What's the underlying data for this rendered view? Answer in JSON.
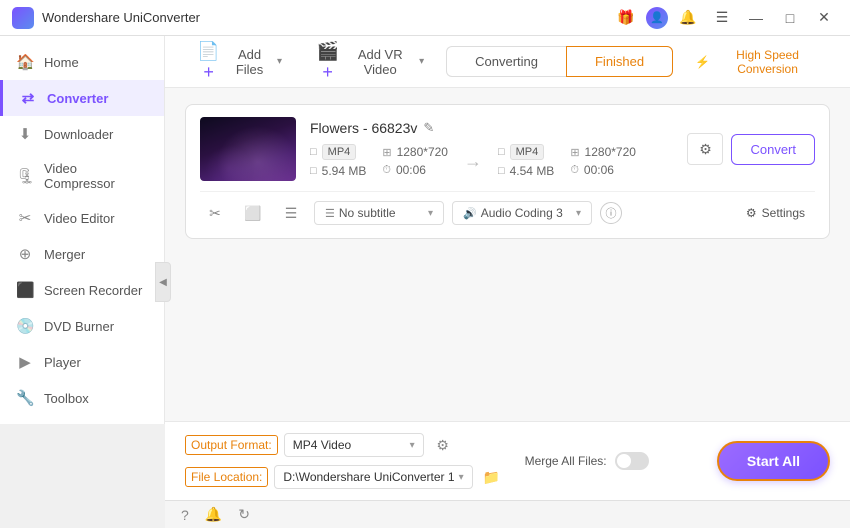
{
  "titlebar": {
    "app_name": "Wondershare UniConverter",
    "controls": {
      "gift_icon": "🎁",
      "user_icon": "👤",
      "bell_icon": "🔔",
      "menu_icon": "☰",
      "minimize_icon": "—",
      "maximize_icon": "□",
      "close_icon": "✕"
    }
  },
  "sidebar": {
    "items": [
      {
        "id": "home",
        "label": "Home",
        "icon": "🏠"
      },
      {
        "id": "converter",
        "label": "Converter",
        "icon": "⇄",
        "active": true
      },
      {
        "id": "downloader",
        "label": "Downloader",
        "icon": "⬇"
      },
      {
        "id": "video-compressor",
        "label": "Video Compressor",
        "icon": "🗜"
      },
      {
        "id": "video-editor",
        "label": "Video Editor",
        "icon": "✂"
      },
      {
        "id": "merger",
        "label": "Merger",
        "icon": "⊕"
      },
      {
        "id": "screen-recorder",
        "label": "Screen Recorder",
        "icon": "⬛"
      },
      {
        "id": "dvd-burner",
        "label": "DVD Burner",
        "icon": "💿"
      },
      {
        "id": "player",
        "label": "Player",
        "icon": "▶"
      },
      {
        "id": "toolbox",
        "label": "Toolbox",
        "icon": "🔧"
      }
    ]
  },
  "toolbar": {
    "add_file_label": "Add Files",
    "add_vr_label": "Add VR Video",
    "chevron": "▾"
  },
  "tabs": {
    "converting": "Converting",
    "finished": "Finished"
  },
  "high_speed": {
    "label": "High Speed Conversion",
    "icon": "⚡"
  },
  "file_card": {
    "filename": "Flowers - 66823v",
    "edit_icon": "✎",
    "source": {
      "format": "MP4",
      "resolution": "1280*720",
      "size": "5.94 MB",
      "duration": "00:06"
    },
    "arrow": "→",
    "dest": {
      "format": "MP4",
      "resolution": "1280*720",
      "size": "4.54 MB",
      "duration": "00:06"
    },
    "actions": {
      "settings_icon": "⚙",
      "convert_label": "Convert"
    },
    "bottom": {
      "cut_icon": "✂",
      "copy_icon": "⬜",
      "list_icon": "☰",
      "subtitle_label": "No subtitle",
      "audio_label": "Audio Coding 3",
      "info_icon": "ⓘ",
      "settings_label": "Settings",
      "settings_icon": "⚙"
    }
  },
  "footer": {
    "output_format_label": "Output Format:",
    "output_format_value": "MP4 Video",
    "file_location_label": "File Location:",
    "file_location_value": "D:\\Wondershare UniConverter 1",
    "folder_icon": "📁",
    "settings_icon": "⚙",
    "merge_label": "Merge All Files:",
    "start_all_label": "Start All",
    "chevron": "▾"
  },
  "status_bar": {
    "help_icon": "?",
    "bell_icon": "🔔",
    "refresh_icon": "↻"
  }
}
